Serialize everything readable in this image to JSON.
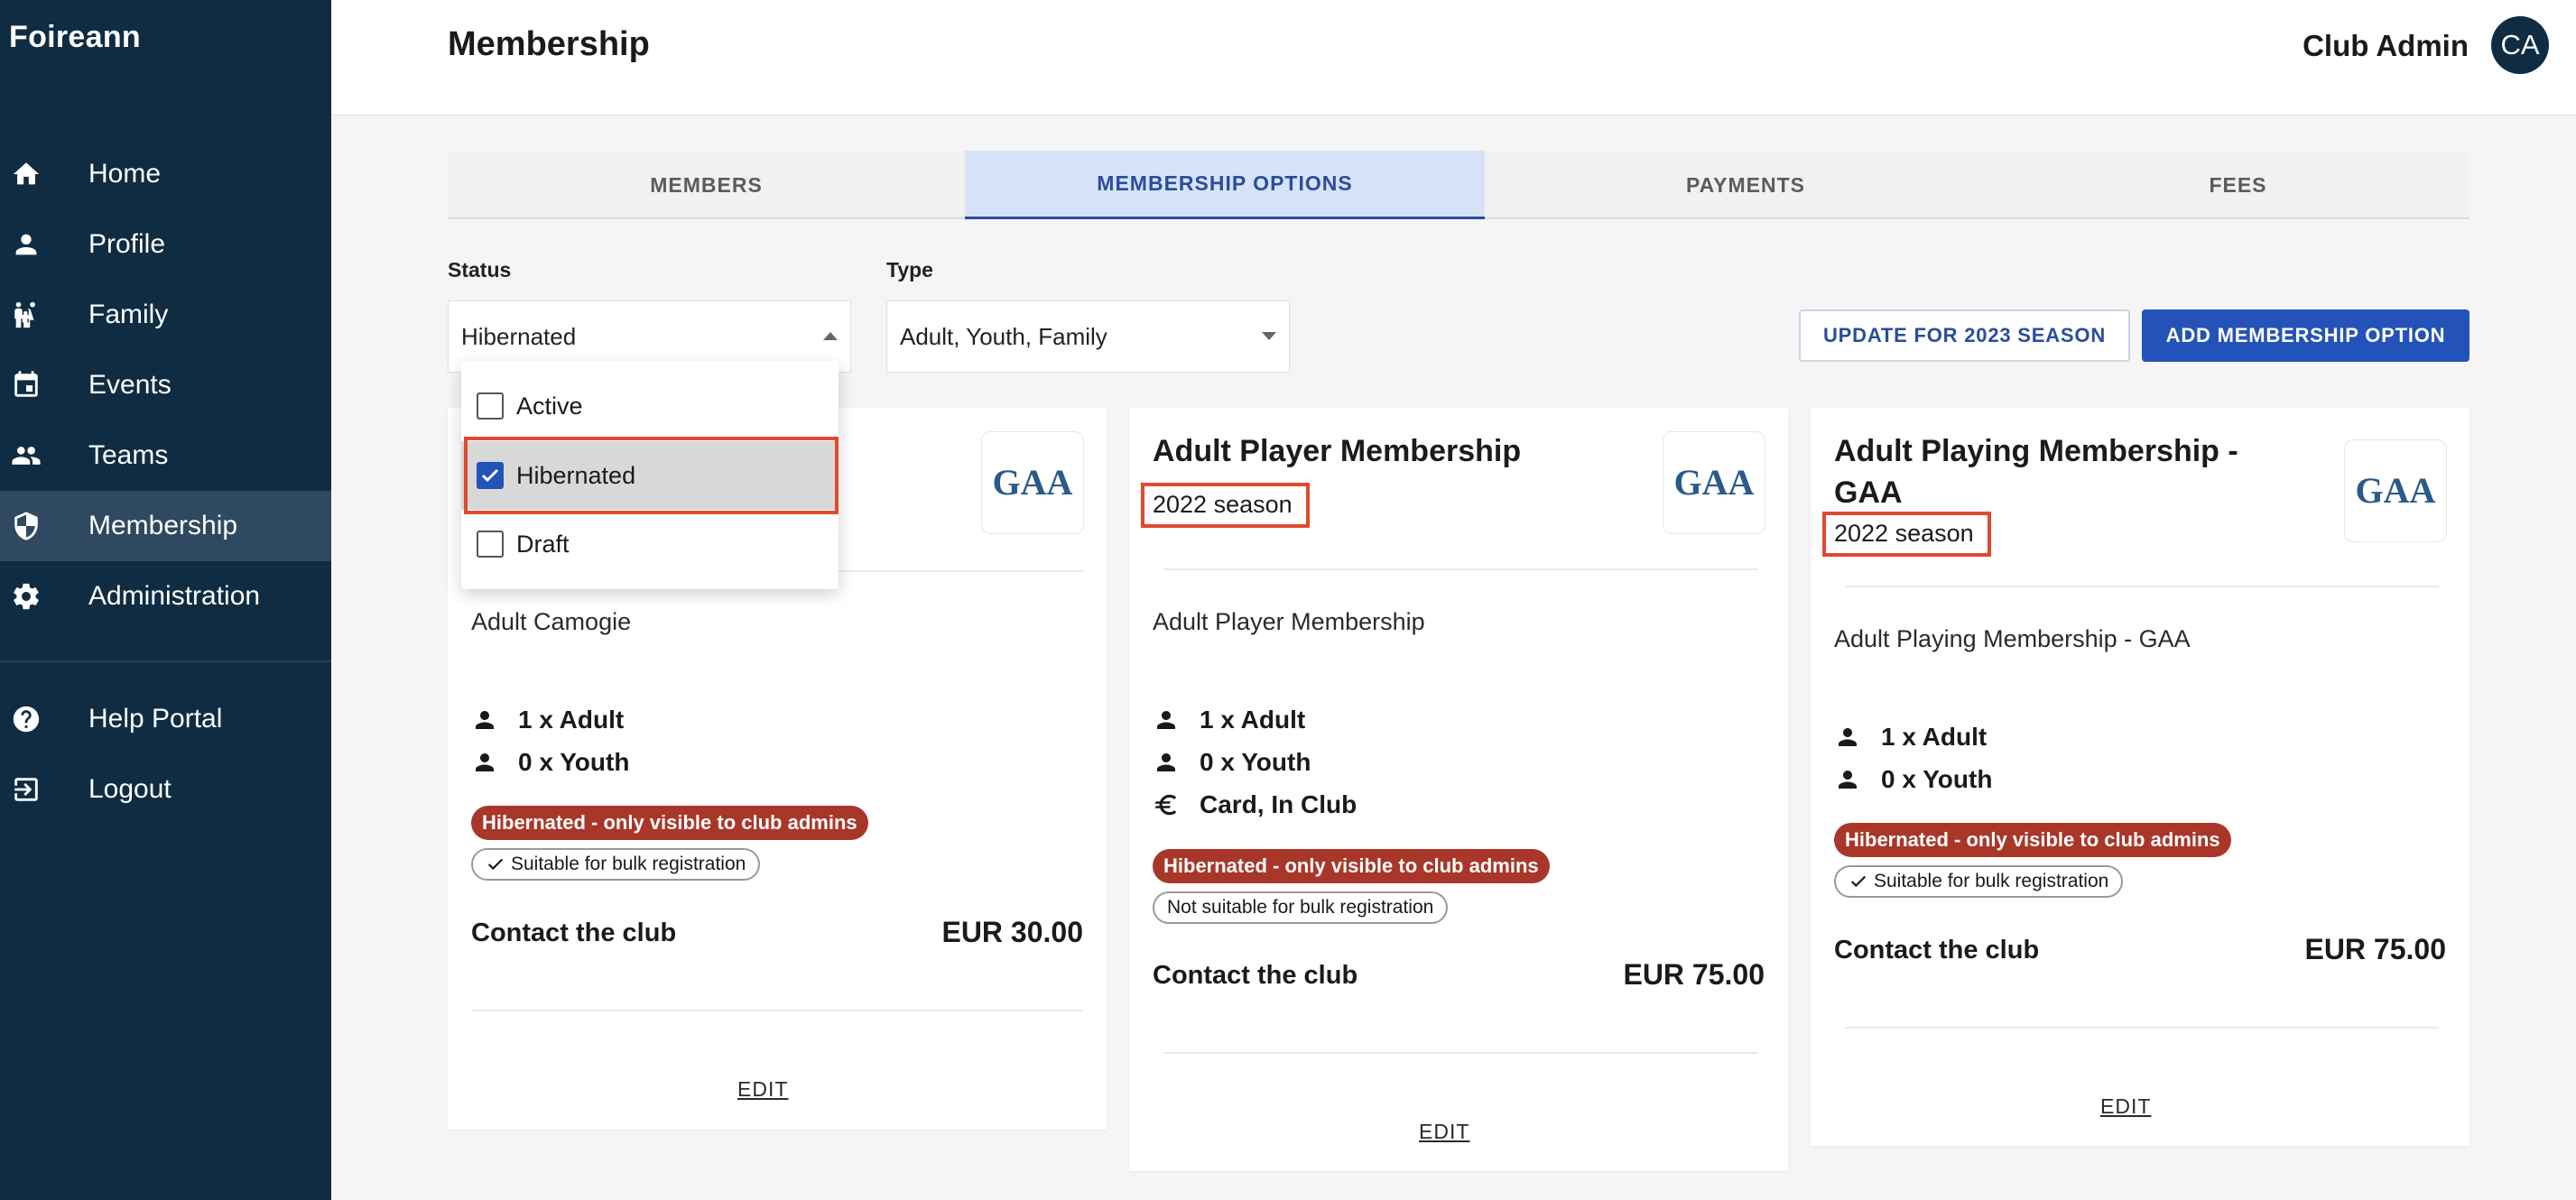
{
  "app": {
    "name": "Foireann"
  },
  "sidebar": {
    "items": [
      {
        "label": "Home",
        "icon": "home-icon"
      },
      {
        "label": "Profile",
        "icon": "person-icon"
      },
      {
        "label": "Family",
        "icon": "family-icon"
      },
      {
        "label": "Events",
        "icon": "calendar-icon"
      },
      {
        "label": "Teams",
        "icon": "group-icon"
      },
      {
        "label": "Membership",
        "icon": "shield-icon",
        "active": true
      },
      {
        "label": "Administration",
        "icon": "gear-icon"
      }
    ],
    "bottom_items": [
      {
        "label": "Help Portal",
        "icon": "help-icon"
      },
      {
        "label": "Logout",
        "icon": "logout-icon"
      }
    ]
  },
  "header": {
    "title": "Membership",
    "user_name": "Club Admin",
    "avatar_initials": "CA"
  },
  "tabs": [
    {
      "label": "MEMBERS"
    },
    {
      "label": "MEMBERSHIP OPTIONS",
      "active": true
    },
    {
      "label": "PAYMENTS"
    },
    {
      "label": "FEES"
    }
  ],
  "filters": {
    "status": {
      "label": "Status",
      "value": "Hibernated",
      "open": true,
      "options": [
        {
          "label": "Active",
          "checked": false
        },
        {
          "label": "Hibernated",
          "checked": true
        },
        {
          "label": "Draft",
          "checked": false
        }
      ]
    },
    "type": {
      "label": "Type",
      "value": "Adult, Youth, Family"
    }
  },
  "actions": {
    "update_season": "UPDATE FOR 2023 SEASON",
    "add_option": "ADD MEMBERSHIP OPTION"
  },
  "logo_text": "GAA",
  "cards": [
    {
      "description": "Adult Camogie",
      "counts": [
        {
          "label": "1 x Adult",
          "icon": "person-icon"
        },
        {
          "label": "0 x Youth",
          "icon": "person-icon"
        }
      ],
      "status_badge": "Hibernated - only visible to club admins",
      "bulk_badge": "Suitable for bulk registration",
      "contact": "Contact the club",
      "price": "EUR 30.00",
      "edit": "EDIT"
    },
    {
      "title": "Adult Player Membership",
      "season": "2022 season",
      "description": "Adult Player Membership",
      "counts": [
        {
          "label": "1 x Adult",
          "icon": "person-icon"
        },
        {
          "label": "0 x Youth",
          "icon": "person-icon"
        },
        {
          "label": "Card, In Club",
          "icon": "euro-icon"
        }
      ],
      "status_badge": "Hibernated - only visible to club admins",
      "bulk_badge": "Not suitable for bulk registration",
      "contact": "Contact the club",
      "price": "EUR 75.00",
      "edit": "EDIT"
    },
    {
      "title_line1": "Adult Playing Membership -",
      "title_line2": "GAA",
      "season": "2022 season",
      "description": "Adult Playing Membership - GAA",
      "counts": [
        {
          "label": "1 x Adult",
          "icon": "person-icon"
        },
        {
          "label": "0 x Youth",
          "icon": "person-icon"
        }
      ],
      "status_badge": "Hibernated - only visible to club admins",
      "bulk_badge": "Suitable for bulk registration",
      "contact": "Contact the club",
      "price": "EUR 75.00",
      "edit": "EDIT"
    }
  ],
  "colors": {
    "sidebar": "#0f2c42",
    "accent": "#2353b8",
    "badge_red": "#a8372a",
    "highlight_red": "#e04a2f"
  }
}
